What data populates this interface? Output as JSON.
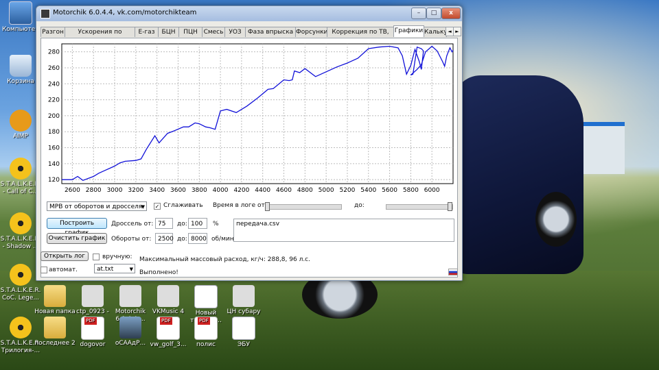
{
  "desktop": {
    "icons": [
      {
        "label": "Компьютер",
        "type": "comp"
      },
      {
        "label": "Корзина",
        "type": "trash"
      },
      {
        "label": "AIMP",
        "type": "aimp"
      },
      {
        "label": "S.T.A.L.K.E.R. - Call of C...",
        "type": "nuke"
      },
      {
        "label": "S.T.A.L.K.E.R. - Shadow ...",
        "type": "nuke"
      },
      {
        "label": "S.T.A.L.K.E.R. CoC. Lege...",
        "type": "nuke"
      },
      {
        "label": "S.T.A.L.K.E.R. Трилогия-...",
        "type": "nuke"
      },
      {
        "label": "Новая папка",
        "type": "folder"
      },
      {
        "label": "последнее 2",
        "type": "folder"
      },
      {
        "label": "ctp_0923 - Ярлык",
        "type": "blank"
      },
      {
        "label": "dogovor",
        "type": "pdf"
      },
      {
        "label": "Motorchik 6.0.4.4-...",
        "type": "blank"
      },
      {
        "label": "оСААдР...",
        "type": "img"
      },
      {
        "label": "VKMusic 4",
        "type": "blank"
      },
      {
        "label": "vw_golf_3...",
        "type": "pdf"
      },
      {
        "label": "Новый текстов...",
        "type": "doc"
      },
      {
        "label": "полис",
        "type": "pdf"
      },
      {
        "label": "ЦН субару",
        "type": "blank"
      },
      {
        "label": "ЭБУ",
        "type": "doc"
      }
    ]
  },
  "window": {
    "title": "Motorchik 6.0.4.4, vk.com/motorchikteam",
    "controls": {
      "minimize": "–",
      "maximize": "□",
      "close": "x"
    },
    "tabs": [
      "Разгон",
      "Ускорения по оборотам",
      "Е-газ",
      "БЦН",
      "ПЦН",
      "Смесь",
      "УОЗ",
      "Фаза впрыска",
      "Форсунки",
      "Коррекция по ТВ, ТОЖ",
      "Графики",
      "Кальку"
    ],
    "active_tab": "Графики",
    "tab_arrows": [
      "◄",
      "►"
    ]
  },
  "controls": {
    "mode_select": "МРВ от оборотов и дросселя",
    "smooth_label": "Сглаживать",
    "smooth_checked": true,
    "log_time_label": "Время в логе от:",
    "to_label": "до:",
    "build_button": "Построить график",
    "clear_button": "Очистить график",
    "throttle_label": "Дроссель от:",
    "throttle_from": "75",
    "throttle_to_label": "до:",
    "throttle_to": "100",
    "throttle_unit": "%",
    "rpm_label": "Обороты от:",
    "rpm_from": "2500",
    "rpm_to_label": "до:",
    "rpm_to": "8000",
    "rpm_unit": "об/мин",
    "files": "передача.csv",
    "open_log_button": "Открыть лог",
    "manual_label": "вручную:",
    "auto_label": "автомат.",
    "file_select": "at.txt",
    "max_flow": "Максимальный массовый расход, кг/ч: 288,8, 96 л.с.",
    "status": "Выполнено!"
  },
  "chart_data": {
    "type": "line",
    "title": "",
    "xlabel": "",
    "ylabel": "",
    "xlim": [
      2500,
      6200
    ],
    "ylim": [
      115,
      290
    ],
    "xticks": [
      2600,
      2800,
      3000,
      3200,
      3400,
      3600,
      3800,
      4000,
      4200,
      4400,
      4600,
      4800,
      5000,
      5200,
      5400,
      5600,
      5800,
      6000
    ],
    "yticks": [
      120,
      140,
      160,
      180,
      200,
      220,
      240,
      260,
      280
    ],
    "grid": true,
    "series": [
      {
        "color": "#1010d8",
        "x": [
          2500,
          2600,
          2650,
          2700,
          2800,
          2850,
          2900,
          3000,
          3050,
          3100,
          3200,
          3250,
          3300,
          3380,
          3420,
          3500,
          3560,
          3650,
          3700,
          3760,
          3800,
          3860,
          3900,
          3950,
          4000,
          4060,
          4150,
          4250,
          4350,
          4450,
          4500,
          4600,
          4650,
          4680,
          4700,
          4750,
          4800,
          4900,
          5000,
          5100,
          5200,
          5300,
          5400,
          5500,
          5600,
          5680,
          5720,
          5760,
          5800,
          5840,
          5880,
          5900,
          5920,
          5900,
          5860,
          5820,
          5800,
          5860,
          5900,
          5940,
          6000,
          6050,
          6100,
          6120,
          6140,
          6170,
          6190,
          6200
        ],
        "y": [
          120,
          120,
          124,
          119,
          124,
          128,
          131,
          137,
          141,
          143,
          144,
          146,
          158,
          175,
          166,
          178,
          181,
          186,
          186,
          191,
          190,
          186,
          185,
          183,
          206,
          208,
          204,
          212,
          222,
          233,
          234,
          245,
          244,
          245,
          256,
          254,
          259,
          249,
          255,
          261,
          266,
          272,
          284,
          286,
          287,
          285,
          275,
          252,
          263,
          283,
          268,
          258,
          281,
          284,
          286,
          252,
          251,
          258,
          264,
          280,
          287,
          281,
          268,
          262,
          275,
          285,
          280,
          282
        ]
      }
    ]
  }
}
